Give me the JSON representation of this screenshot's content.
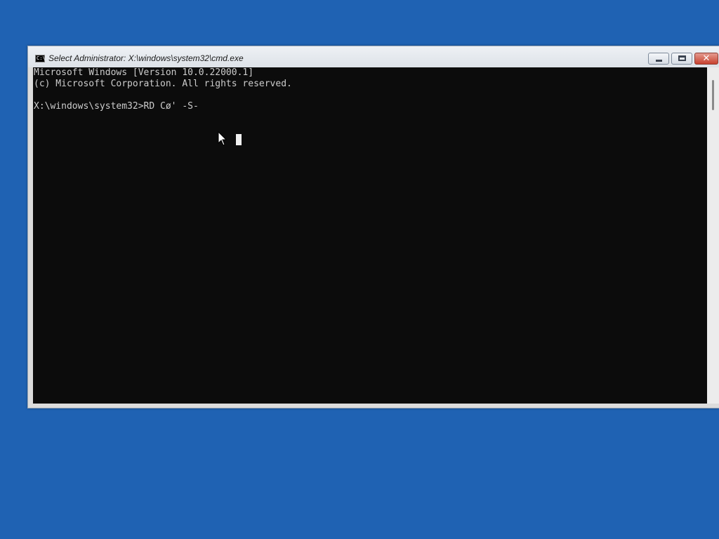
{
  "window": {
    "title": "Select Administrator: X:\\windows\\system32\\cmd.exe",
    "app_icon": "cmd-icon",
    "app_icon_text": "C:\\",
    "minimize_icon": "minimize-icon",
    "maximize_icon": "maximize-icon",
    "close_icon": "close-icon",
    "close_glyph": "✕"
  },
  "console": {
    "lines": [
      "Microsoft Windows [Version 10.0.22000.1]",
      "(c) Microsoft Corporation. All rights reserved.",
      "",
      "X:\\windows\\system32>RD Cø' -S-"
    ]
  },
  "colors": {
    "desktop": "#1f62b3",
    "console_background": "#0c0c0c",
    "console_text": "#cccccc",
    "close_button": "#c8422f"
  }
}
